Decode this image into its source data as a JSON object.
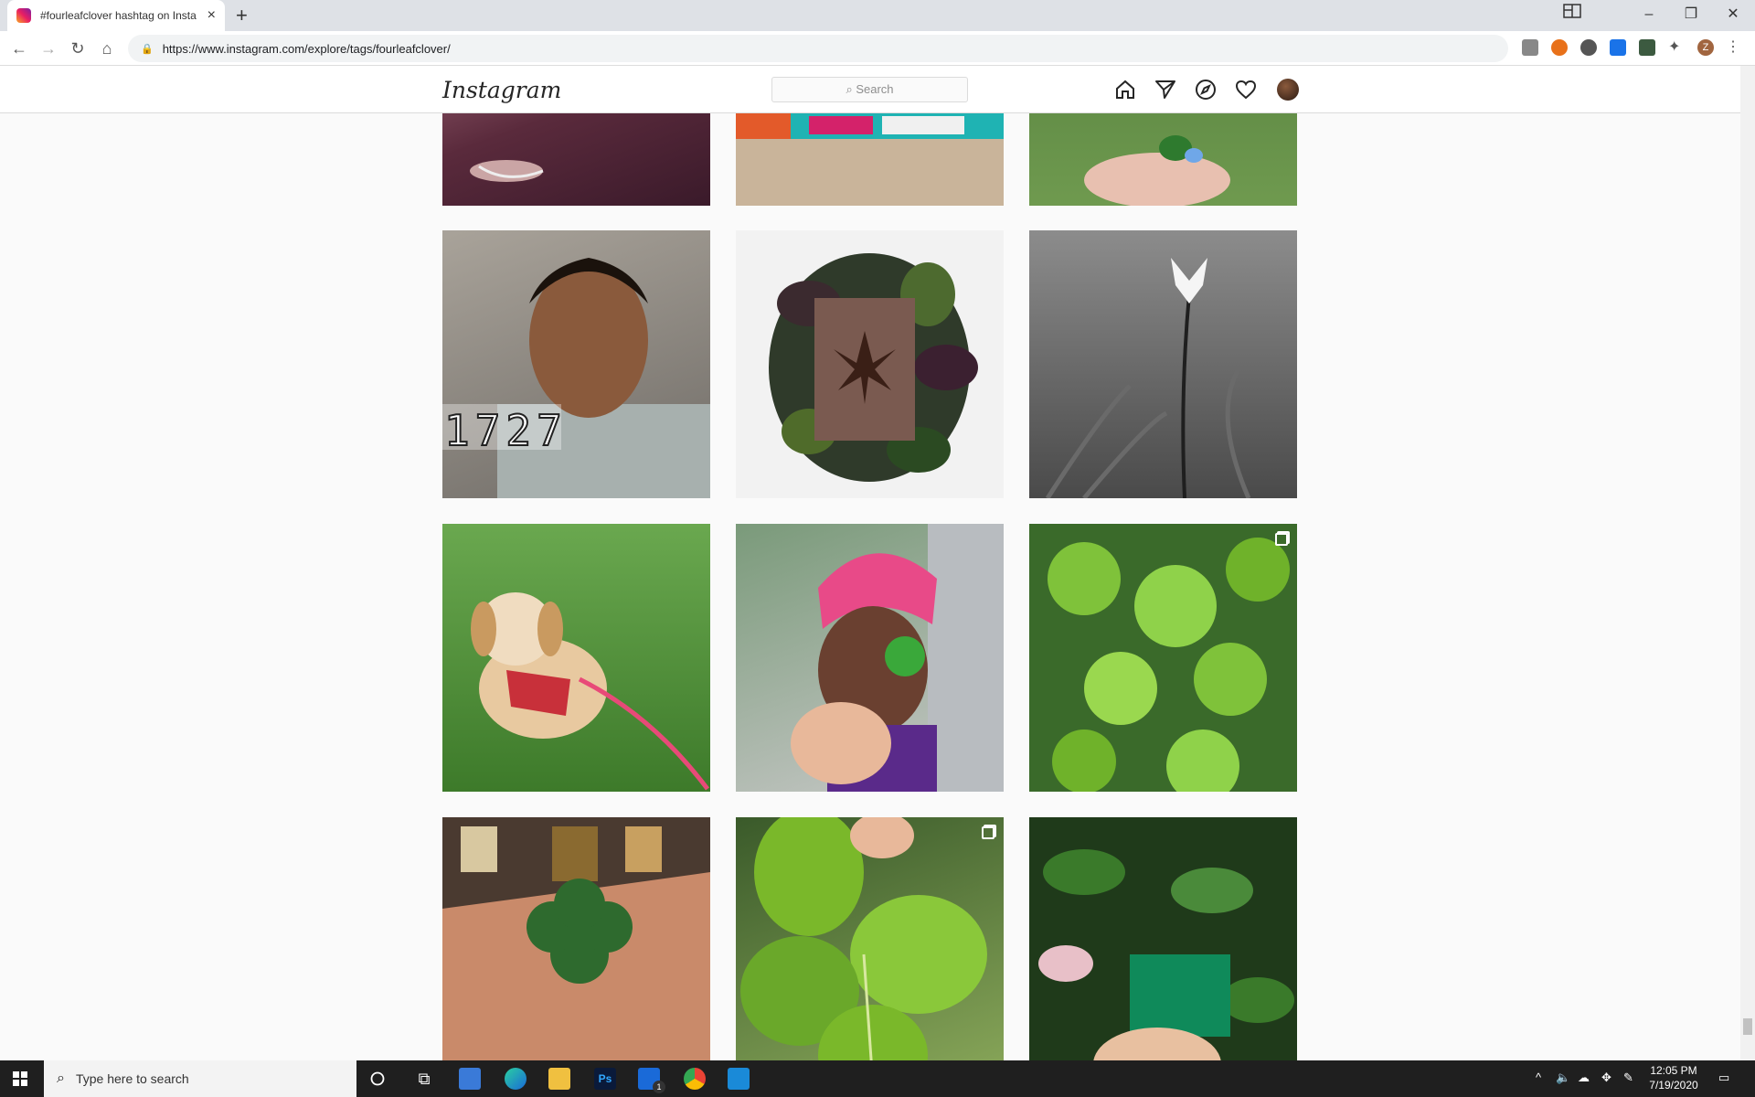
{
  "browser": {
    "tab_title": "#fourleafclover hashtag on Insta",
    "new_tab_symbol": "+",
    "close_symbol": "×",
    "url": "https://www.instagram.com/explore/tags/fourleafclover/",
    "profile_initial": "Z"
  },
  "instagram": {
    "logo_text": "Instagram",
    "search_placeholder": "Search"
  },
  "posts": [
    {
      "row": 0,
      "col": 0,
      "desc": "partial photo of person with bracelet"
    },
    {
      "row": 0,
      "col": 1,
      "desc": "partial photo of banner"
    },
    {
      "row": 0,
      "col": 2,
      "desc": "partial photo hand on grass"
    },
    {
      "row": 1,
      "col": 0,
      "overlay_text": "1727"
    },
    {
      "row": 1,
      "col": 1
    },
    {
      "row": 1,
      "col": 2
    },
    {
      "row": 2,
      "col": 0
    },
    {
      "row": 2,
      "col": 1
    },
    {
      "row": 2,
      "col": 2,
      "multiple": true
    },
    {
      "row": 3,
      "col": 0
    },
    {
      "row": 3,
      "col": 1,
      "multiple": true
    },
    {
      "row": 3,
      "col": 2
    }
  ],
  "taskbar": {
    "search_placeholder": "Type here to search",
    "time": "12:05 PM",
    "date": "7/19/2020",
    "mail_badge": "1"
  }
}
